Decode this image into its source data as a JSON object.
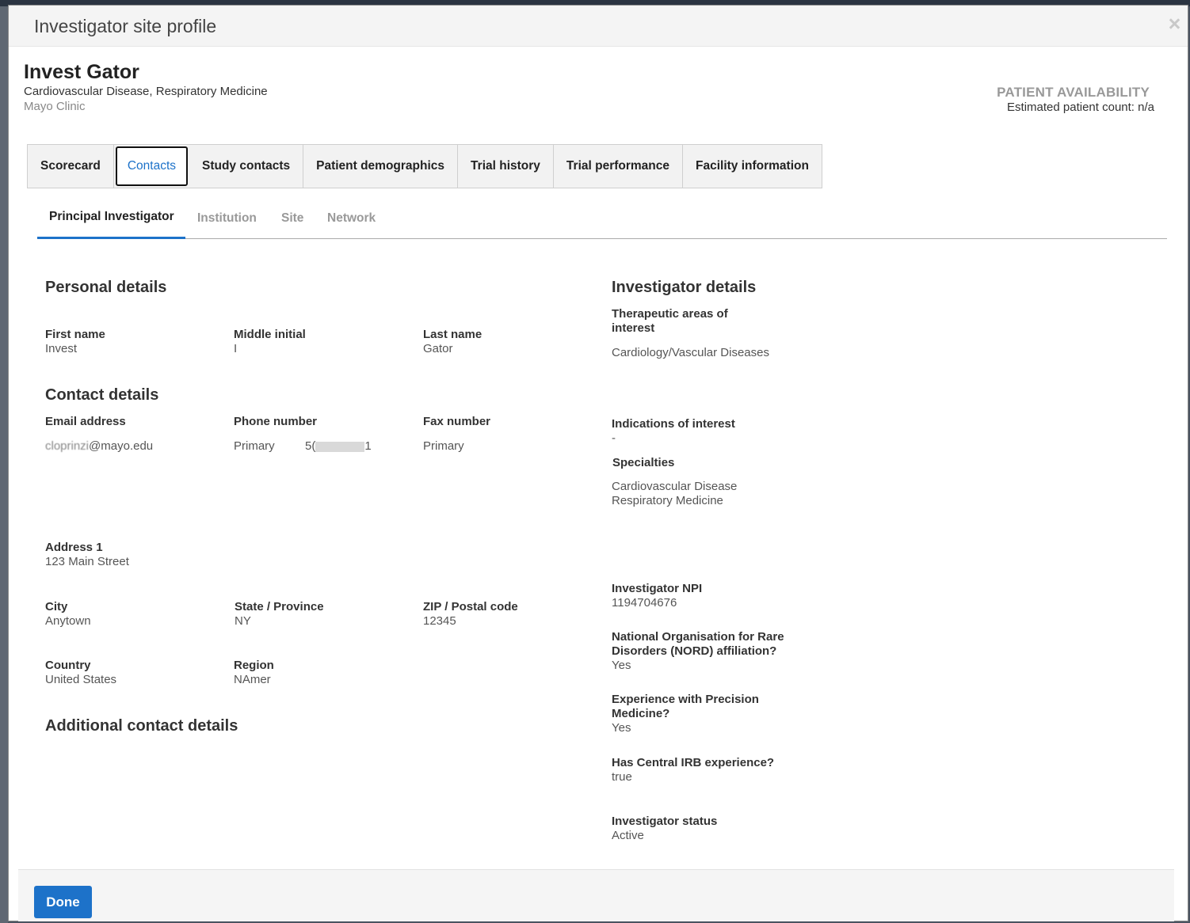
{
  "modal": {
    "title": "Investigator site profile"
  },
  "investigator": {
    "name": "Invest Gator",
    "specialties_line": "Cardiovascular Disease, Respiratory Medicine",
    "institution": "Mayo Clinic"
  },
  "patient_availability": {
    "title": "PATIENT AVAILABILITY",
    "count_text": "Estimated patient count: n/a"
  },
  "tabs": [
    {
      "label": "Scorecard"
    },
    {
      "label": "Contacts",
      "active": true
    },
    {
      "label": "Study contacts"
    },
    {
      "label": "Patient demographics"
    },
    {
      "label": "Trial history"
    },
    {
      "label": "Trial performance"
    },
    {
      "label": "Facility information"
    }
  ],
  "subtabs": [
    {
      "label": "Principal Investigator",
      "active": true
    },
    {
      "label": "Institution"
    },
    {
      "label": "Site"
    },
    {
      "label": "Network"
    }
  ],
  "personal": {
    "title": "Personal details",
    "first_name_label": "First name",
    "first_name": "Invest",
    "middle_initial_label": "Middle initial",
    "middle_initial": "I",
    "last_name_label": "Last name",
    "last_name": "Gator"
  },
  "contact": {
    "title": "Contact details",
    "email_label": "Email address",
    "email_prefix": "cloprinzi",
    "email_domain": "@mayo.edu",
    "phone_label": "Phone number",
    "phone_type": "Primary",
    "phone_start": "5(",
    "phone_end": "1",
    "fax_label": "Fax number",
    "fax_type": "Primary",
    "address1_label": "Address 1",
    "address1": "123 Main Street",
    "city_label": "City",
    "city": "Anytown",
    "state_label": "State / Province",
    "state": "NY",
    "zip_label": "ZIP / Postal code",
    "zip": "12345",
    "country_label": "Country",
    "country": "United States",
    "region_label": "Region",
    "region": "NAmer"
  },
  "additional": {
    "title": "Additional contact details"
  },
  "investigator_details": {
    "title": "Investigator details",
    "therapeutic_label_1": "Therapeutic areas of",
    "therapeutic_label_2": "interest",
    "therapeutic_value": "Cardiology/Vascular Diseases",
    "indications_label": "Indications of interest",
    "indications_value": "-",
    "specialties_label": "Specialties",
    "specialty_1": "Cardiovascular Disease",
    "specialty_2": "Respiratory Medicine",
    "npi_label": "Investigator NPI",
    "npi_value": "1194704676",
    "nord_label_1": "National Organisation for Rare",
    "nord_label_2": "Disorders (NORD) affiliation?",
    "nord_value": "Yes",
    "precision_label_1": "Experience with Precision",
    "precision_label_2": "Medicine?",
    "precision_value": "Yes",
    "irb_label": "Has Central IRB experience?",
    "irb_value": "true",
    "status_label": "Investigator status",
    "status_value": "Active"
  },
  "footer": {
    "done_label": "Done"
  },
  "colors": {
    "accent": "#1d72c9",
    "backdrop": "#4a5360"
  }
}
